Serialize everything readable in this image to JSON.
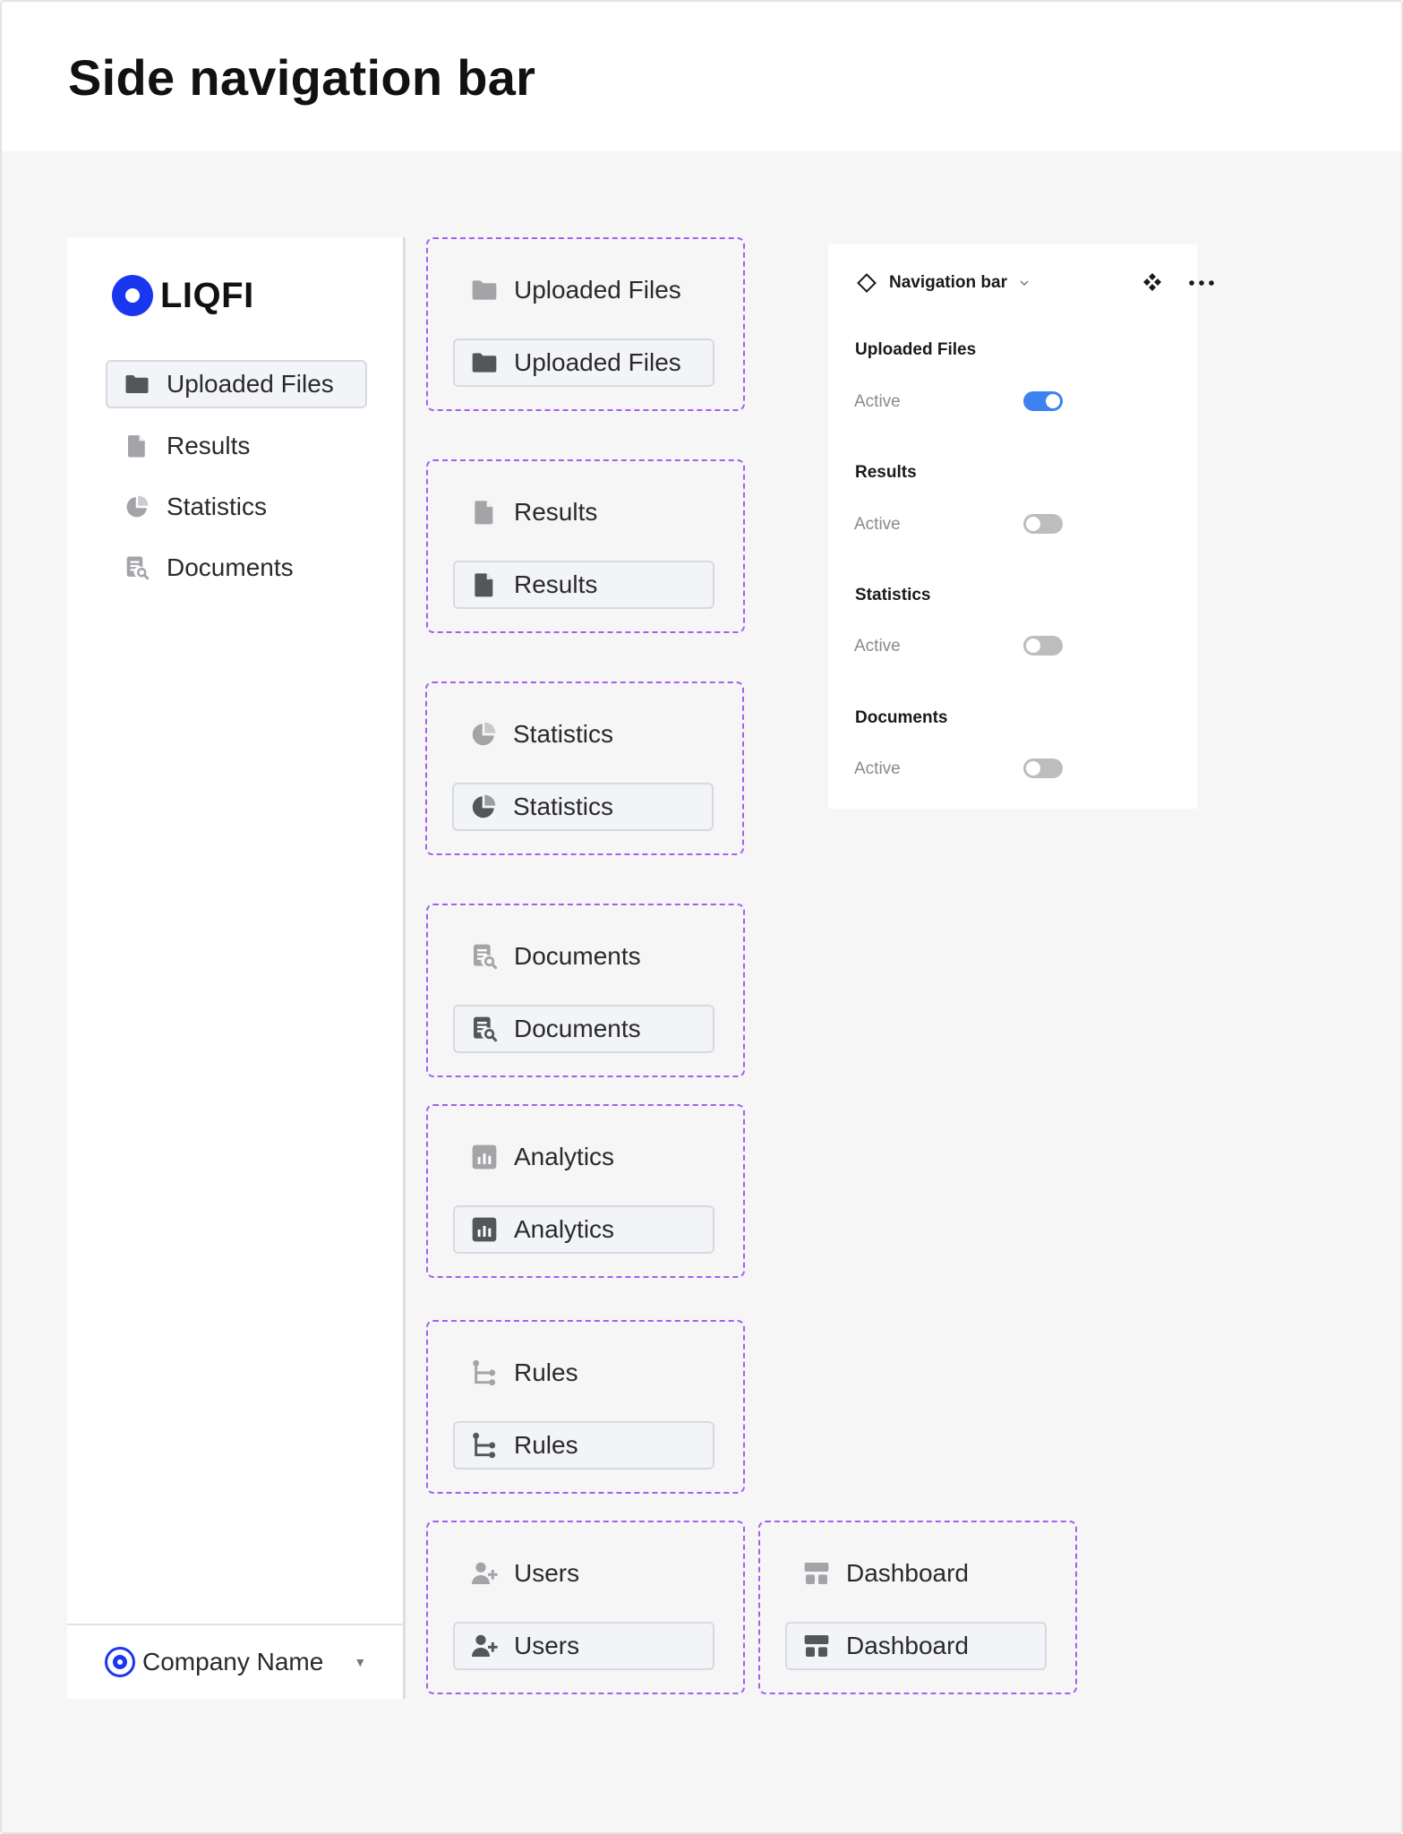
{
  "page": {
    "title": "Side navigation bar"
  },
  "sidebar": {
    "brand": "LIQFI",
    "items": [
      {
        "label": "Uploaded Files",
        "icon": "folder-icon",
        "active": true
      },
      {
        "label": "Results",
        "icon": "file-icon",
        "active": false
      },
      {
        "label": "Statistics",
        "icon": "pie-chart-icon",
        "active": false
      },
      {
        "label": "Documents",
        "icon": "document-search-icon",
        "active": false
      }
    ],
    "footer": {
      "label": "Company Name",
      "icon": "caret-down-icon"
    }
  },
  "variants": [
    {
      "name": "uploaded-files",
      "label": "Uploaded Files",
      "icon": "folder-icon"
    },
    {
      "name": "results",
      "label": "Results",
      "icon": "file-icon"
    },
    {
      "name": "statistics",
      "label": "Statistics",
      "icon": "pie-chart-icon"
    },
    {
      "name": "documents",
      "label": "Documents",
      "icon": "document-search-icon"
    },
    {
      "name": "analytics",
      "label": "Analytics",
      "icon": "bar-chart-icon"
    },
    {
      "name": "rules",
      "label": "Rules",
      "icon": "tree-icon"
    },
    {
      "name": "users",
      "label": "Users",
      "icon": "user-add-icon"
    },
    {
      "name": "dashboard",
      "label": "Dashboard",
      "icon": "dashboard-icon"
    }
  ],
  "properties": {
    "title": "Navigation bar",
    "props": [
      {
        "label": "Uploaded Files",
        "state": "Active",
        "on": true
      },
      {
        "label": "Results",
        "state": "Active",
        "on": false
      },
      {
        "label": "Statistics",
        "state": "Active",
        "on": false
      },
      {
        "label": "Documents",
        "state": "Active",
        "on": false
      }
    ]
  },
  "colors": {
    "brand": "#1a37f0",
    "variant_border": "#a45ff0",
    "toggle_on": "#3d82f0",
    "toggle_off": "#bdbdbd",
    "icon_default": "#a3a3a8",
    "icon_active": "#55565a"
  }
}
